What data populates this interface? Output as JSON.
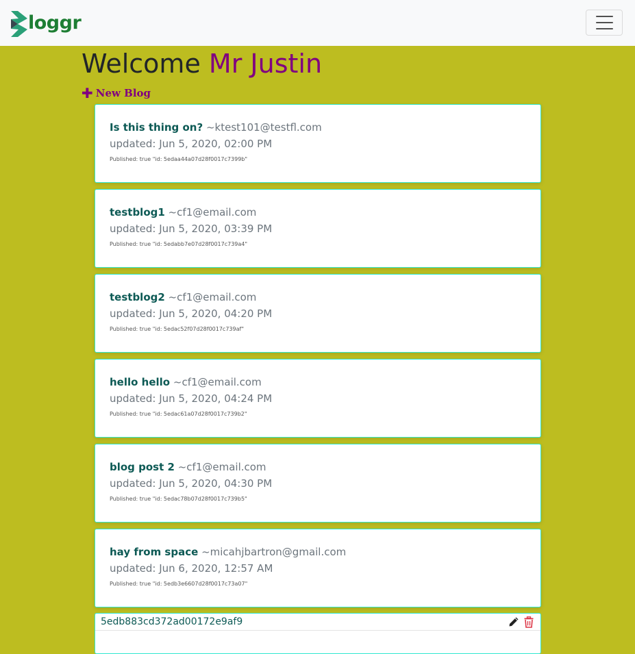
{
  "navbar": {
    "brand_text": "loggr",
    "menu_icon": "hamburger-icon"
  },
  "welcome": {
    "greeting": "Welcome",
    "name": "Mr Justin"
  },
  "new_blog": {
    "icon": "plus-icon",
    "label": "New Blog"
  },
  "blogs": [
    {
      "title": "Is this thing on?",
      "author": "~ktest101@testfl.com",
      "updated": "updated: Jun 5, 2020, 02:00 PM",
      "published": "Published: true \"id: 5edaa44a07d28f0017c7399b\""
    },
    {
      "title": "testblog1",
      "author": "~cf1@email.com",
      "updated": "updated: Jun 5, 2020, 03:39 PM",
      "published": "Published: true \"id: 5edabb7e07d28f0017c739a4\""
    },
    {
      "title": "testblog2",
      "author": "~cf1@email.com",
      "updated": "updated: Jun 5, 2020, 04:20 PM",
      "published": "Published: true \"id: 5edac52f07d28f0017c739af\""
    },
    {
      "title": "hello hello",
      "author": "~cf1@email.com",
      "updated": "updated: Jun 5, 2020, 04:24 PM",
      "published": "Published: true \"id: 5edac61a07d28f0017c739b2\""
    },
    {
      "title": "blog post 2",
      "author": "~cf1@email.com",
      "updated": "updated: Jun 5, 2020, 04:30 PM",
      "published": "Published: true \"id: 5edac78b07d28f0017c739b5\""
    },
    {
      "title": "hay from space",
      "author": "~micahjbartron@gmail.com",
      "updated": "updated: Jun 6, 2020, 12:57 AM",
      "published": "Published: true \"id: 5edb3e6607d28f0017c73a07\""
    }
  ],
  "last_card": {
    "id": "5edb883cd372ad00172e9af9",
    "edit_icon": "pencil-icon",
    "delete_icon": "trash-icon"
  },
  "colors": {
    "page_background": "#bdbd20",
    "accent_purple": "#800080",
    "card_border": "#2ee8cf",
    "title_teal": "#0d5a55",
    "brand_green": "#1e7e34",
    "delete_red": "#dc3545"
  }
}
